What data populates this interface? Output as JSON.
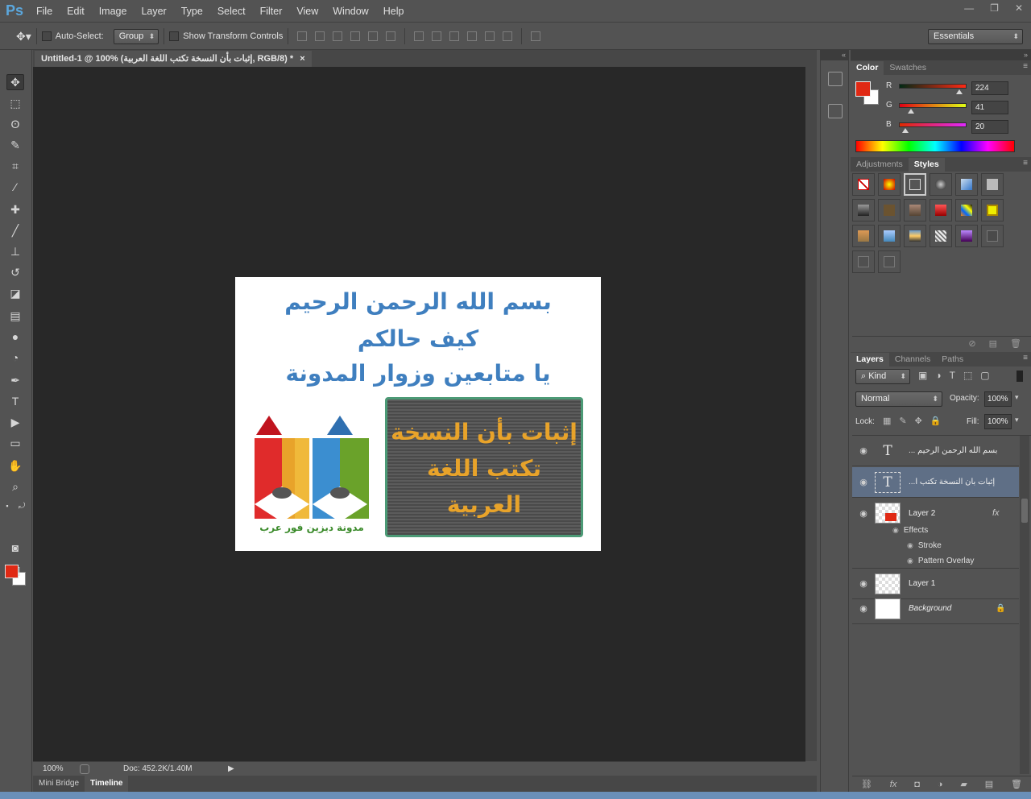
{
  "app": {
    "logo": "Ps"
  },
  "menu": [
    "File",
    "Edit",
    "Image",
    "Layer",
    "Type",
    "Select",
    "Filter",
    "View",
    "Window",
    "Help"
  ],
  "options": {
    "auto_select_label": "Auto-Select:",
    "auto_select_value": "Group",
    "transform_label": "Show Transform Controls",
    "workspace": "Essentials"
  },
  "document": {
    "tab_title": "Untitled-1 @ 100% (إثبات بأن النسخة تكتب اللغة العربية, RGB/8) *",
    "close": "×",
    "canvas": {
      "line1": "بسم الله الرحمن الرحيم",
      "line2": "كيف حالكم",
      "line3": "يا متابعين وزوار المدونة",
      "box_line1": "إثبات بأن النسخة",
      "box_line2": "تكتب اللغة",
      "box_line3": "العربية",
      "caption": "مدونة ديزين فور عرب"
    },
    "zoom": "100%",
    "doc_info": "Doc: 452.2K/1.40M"
  },
  "bottom_tabs": [
    "Mini Bridge",
    "Timeline"
  ],
  "color_panel": {
    "tabs": [
      "Color",
      "Swatches"
    ],
    "foreground": "#e02914",
    "r_label": "R",
    "r": "224",
    "g_label": "G",
    "g": "41",
    "b_label": "B",
    "b": "20"
  },
  "styles_panel": {
    "tabs": [
      "Adjustments",
      "Styles"
    ]
  },
  "layers_panel": {
    "tabs": [
      "Layers",
      "Channels",
      "Paths"
    ],
    "filter_kind": "Kind",
    "blend_mode": "Normal",
    "opacity_label": "Opacity:",
    "opacity": "100%",
    "lock_label": "Lock:",
    "fill_label": "Fill:",
    "fill": "100%",
    "layers": [
      {
        "name": "بسم الله الرحمن الرحيم ...",
        "thumb": "T"
      },
      {
        "name": "إثبات بأن النسخة تكتب ا...",
        "thumb": "T"
      },
      {
        "name": "Layer 2",
        "fx": "fx"
      },
      {
        "name": "Layer 1"
      },
      {
        "name": "Background"
      }
    ],
    "effects_label": "Effects",
    "effect1": "Stroke",
    "effect2": "Pattern Overlay"
  }
}
